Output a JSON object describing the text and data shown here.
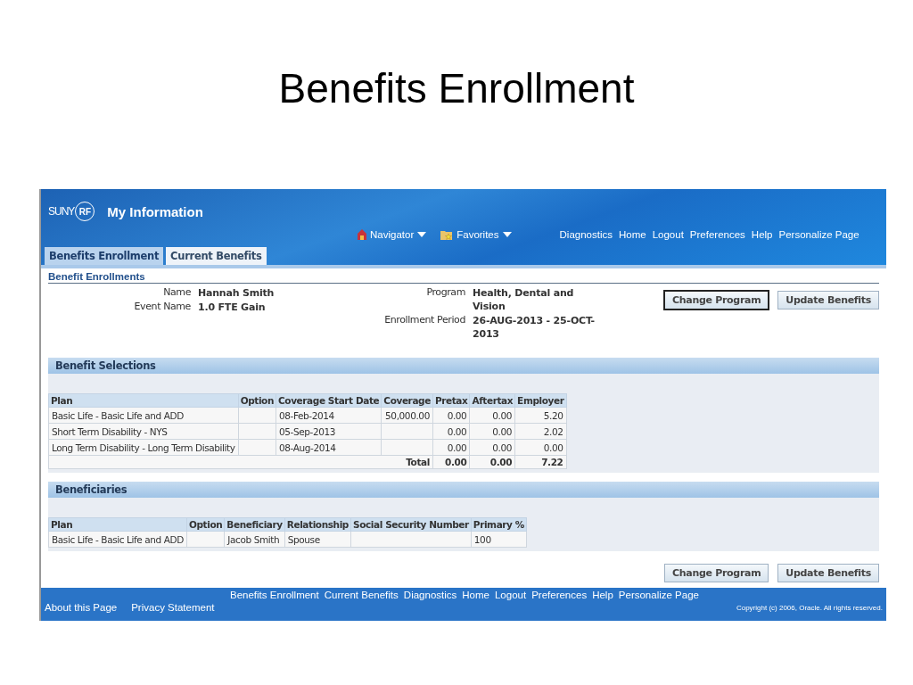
{
  "slide_title": "Benefits Enrollment",
  "header": {
    "logo": {
      "text": "SUNY",
      "badge": "RF"
    },
    "app_title": "My Information",
    "menus": [
      {
        "label": "Navigator",
        "kind": "navigator"
      },
      {
        "label": "Favorites",
        "kind": "favorites"
      }
    ],
    "global_links": [
      "Diagnostics",
      "Home",
      "Logout",
      "Preferences",
      "Help",
      "Personalize Page"
    ]
  },
  "tabs": [
    {
      "label": "Benefits Enrollment",
      "selected": true
    },
    {
      "label": "Current Benefits",
      "selected": false
    }
  ],
  "page_heading": "Benefit Enrollments",
  "details_left": [
    {
      "label": "Name",
      "value": "Hannah Smith"
    },
    {
      "label": "Event Name",
      "value": "1.0 FTE Gain"
    }
  ],
  "details_right": [
    {
      "label": "Program",
      "value": "Health, Dental and Vision"
    },
    {
      "label": "Enrollment Period",
      "value": "26-AUG-2013 - 25-OCT-2013"
    }
  ],
  "top_buttons": [
    {
      "label": "Change Program",
      "focused": true
    },
    {
      "label": "Update Benefits",
      "focused": false
    }
  ],
  "benefit_selections": {
    "title": "Benefit Selections",
    "columns": [
      {
        "label": "Plan",
        "kind": "text"
      },
      {
        "label": "Option",
        "kind": "text"
      },
      {
        "label": "Coverage Start Date",
        "kind": "text"
      },
      {
        "label": "Coverage",
        "kind": "number"
      },
      {
        "label": "Pretax",
        "kind": "number"
      },
      {
        "label": "Aftertax",
        "kind": "number"
      },
      {
        "label": "Employer",
        "kind": "number"
      }
    ],
    "rows": [
      [
        "Basic Life - Basic Life and ADD",
        null,
        "08-Feb-2014",
        "50,000.00",
        "0.00",
        "0.00",
        "5.20"
      ],
      [
        "Short Term Disability - NYS",
        null,
        "05-Sep-2013",
        null,
        "0.00",
        "0.00",
        "2.02"
      ],
      [
        "Long Term Disability - Long Term Disability",
        null,
        "08-Aug-2014",
        null,
        "0.00",
        "0.00",
        "0.00"
      ]
    ],
    "total": {
      "label": "Total",
      "values": [
        "0.00",
        "0.00",
        "7.22"
      ]
    }
  },
  "beneficiaries": {
    "title": "Beneficiaries",
    "columns": [
      {
        "label": "Plan"
      },
      {
        "label": "Option"
      },
      {
        "label": "Beneficiary"
      },
      {
        "label": "Relationship"
      },
      {
        "label": "Social Security Number"
      },
      {
        "label": "Primary %"
      }
    ],
    "rows": [
      [
        "Basic Life - Basic Life and ADD",
        null,
        "Jacob Smith",
        "Spouse",
        null,
        "100"
      ]
    ]
  },
  "bottom_buttons": [
    {
      "label": "Change Program",
      "focused": false
    },
    {
      "label": "Update Benefits",
      "focused": false
    }
  ],
  "footer": {
    "links": [
      "Benefits Enrollment",
      "Current Benefits",
      "Diagnostics",
      "Home",
      "Logout",
      "Preferences",
      "Help",
      "Personalize Page"
    ],
    "bottom_links": [
      "About this Page",
      "Privacy Statement"
    ],
    "copyright": "Copyright (c) 2006, Oracle. All rights reserved."
  }
}
